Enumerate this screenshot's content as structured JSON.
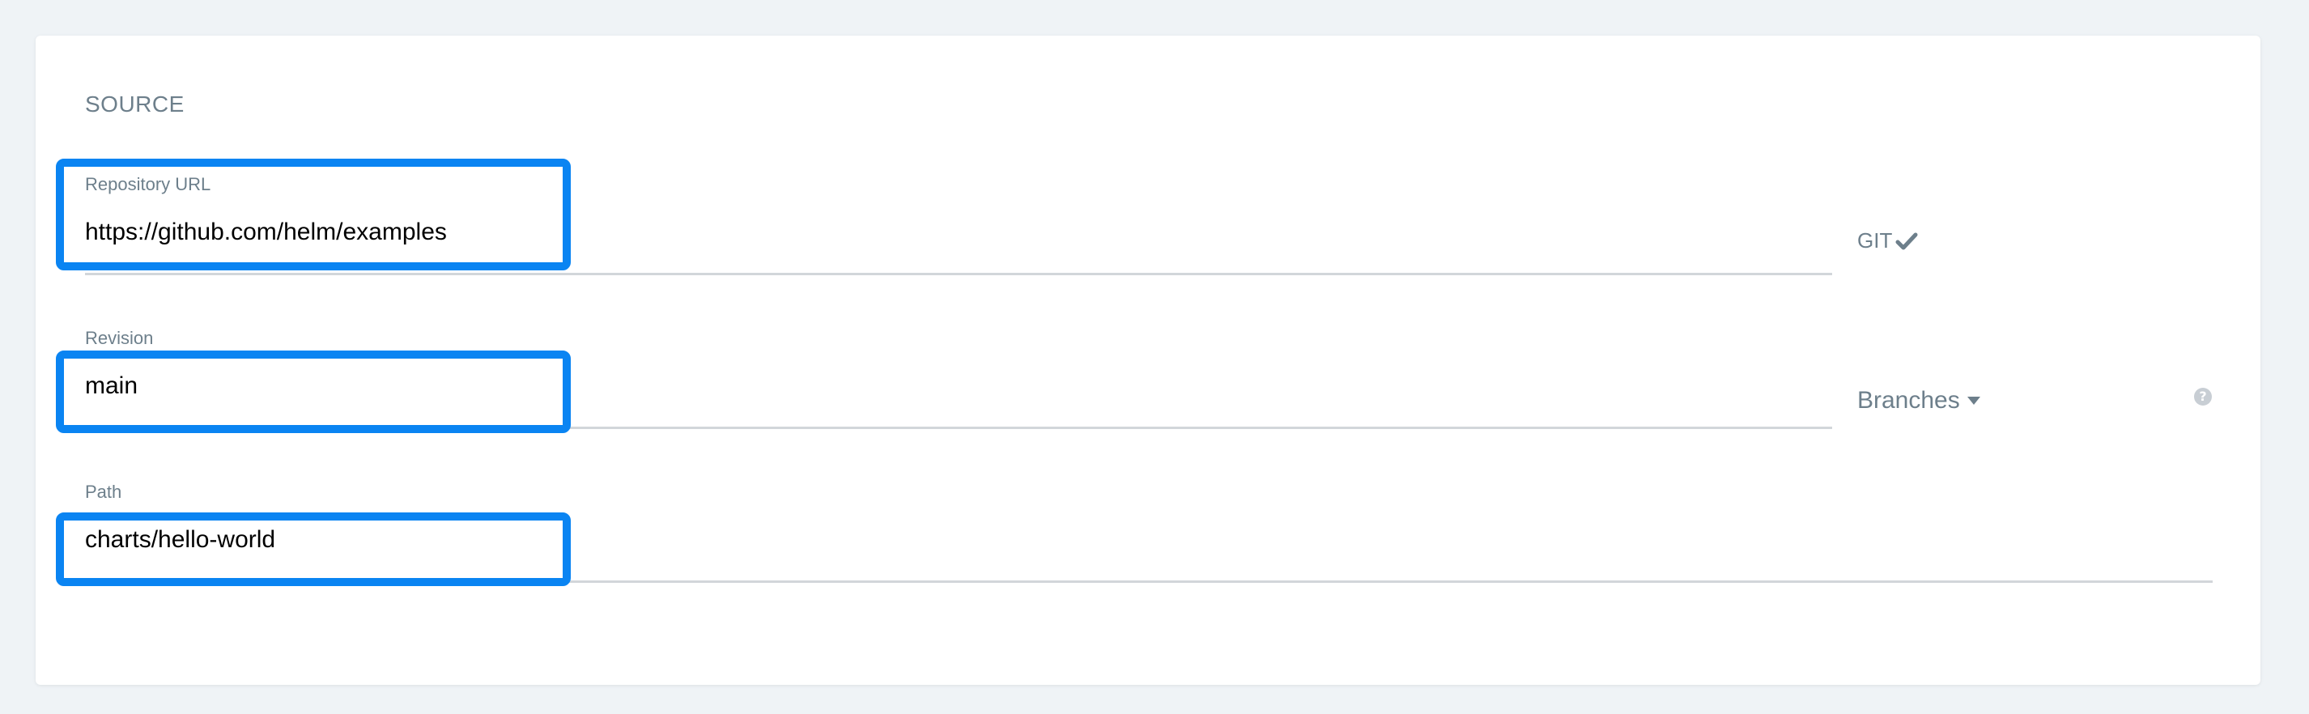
{
  "section": {
    "title": "SOURCE"
  },
  "repository": {
    "label": "Repository URL",
    "value": "https://github.com/helm/examples",
    "type_tag": "GIT"
  },
  "revision": {
    "label": "Revision",
    "value": "main",
    "selector_label": "Branches"
  },
  "path": {
    "label": "Path",
    "value": "charts/hello-world"
  },
  "icons": {
    "git_check": "check-icon",
    "branches_caret": "caret-down-icon",
    "help": "question-circle-icon"
  },
  "colors": {
    "highlight": "#0a84f2",
    "muted_text": "#6d7f8b",
    "underline": "#d2d6da",
    "background": "#eff3f6"
  },
  "help_glyph": "?"
}
